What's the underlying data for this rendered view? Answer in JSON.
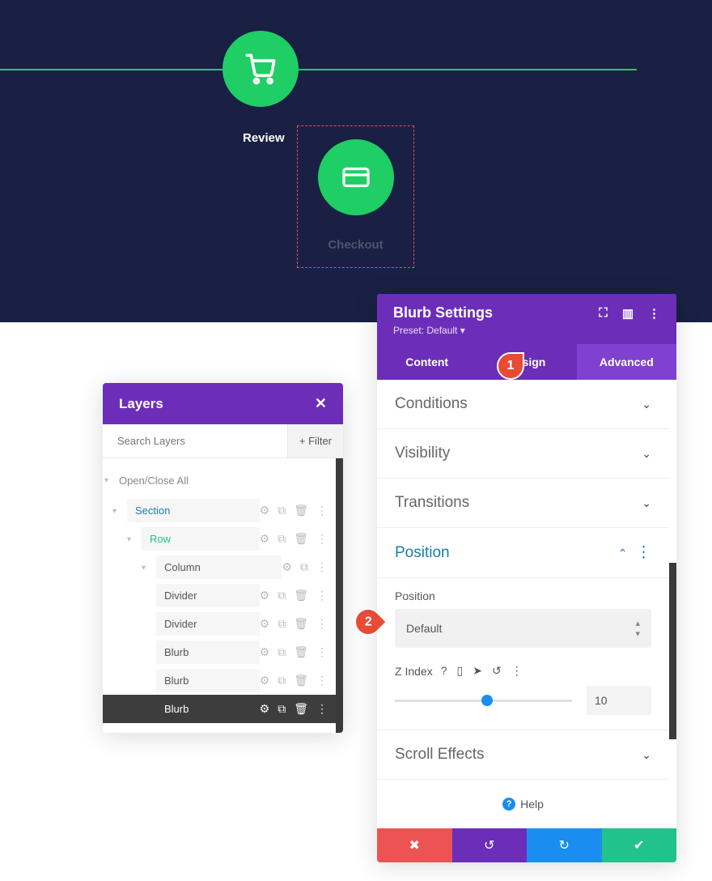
{
  "canvas": {
    "review_label": "Review",
    "checkout_label": "Checkout"
  },
  "layers": {
    "title": "Layers",
    "search_placeholder": "Search Layers",
    "filter_label": "+  Filter",
    "open_close": "Open/Close All",
    "tree": {
      "section": "Section",
      "row": "Row",
      "column": "Column",
      "items": [
        "Divider",
        "Divider",
        "Blurb",
        "Blurb",
        "Blurb"
      ]
    }
  },
  "settings": {
    "title": "Blurb Settings",
    "preset": "Preset: Default ▾",
    "tabs": {
      "content": "Content",
      "design": "Design",
      "advanced": "Advanced"
    },
    "accordion": {
      "conditions": "Conditions",
      "visibility": "Visibility",
      "transitions": "Transitions",
      "position": "Position",
      "scroll": "Scroll Effects"
    },
    "position": {
      "label": "Position",
      "value": "Default",
      "zindex_label": "Z Index",
      "zindex_value": "10"
    },
    "help": "Help"
  },
  "annotations": {
    "one": "1",
    "two": "2"
  },
  "colors": {
    "purple": "#6c2eb9",
    "green": "#1fce64",
    "dark": "#1a2044",
    "red": "#ec5453",
    "blue": "#1a8ef0",
    "teal": "#21c28b"
  }
}
